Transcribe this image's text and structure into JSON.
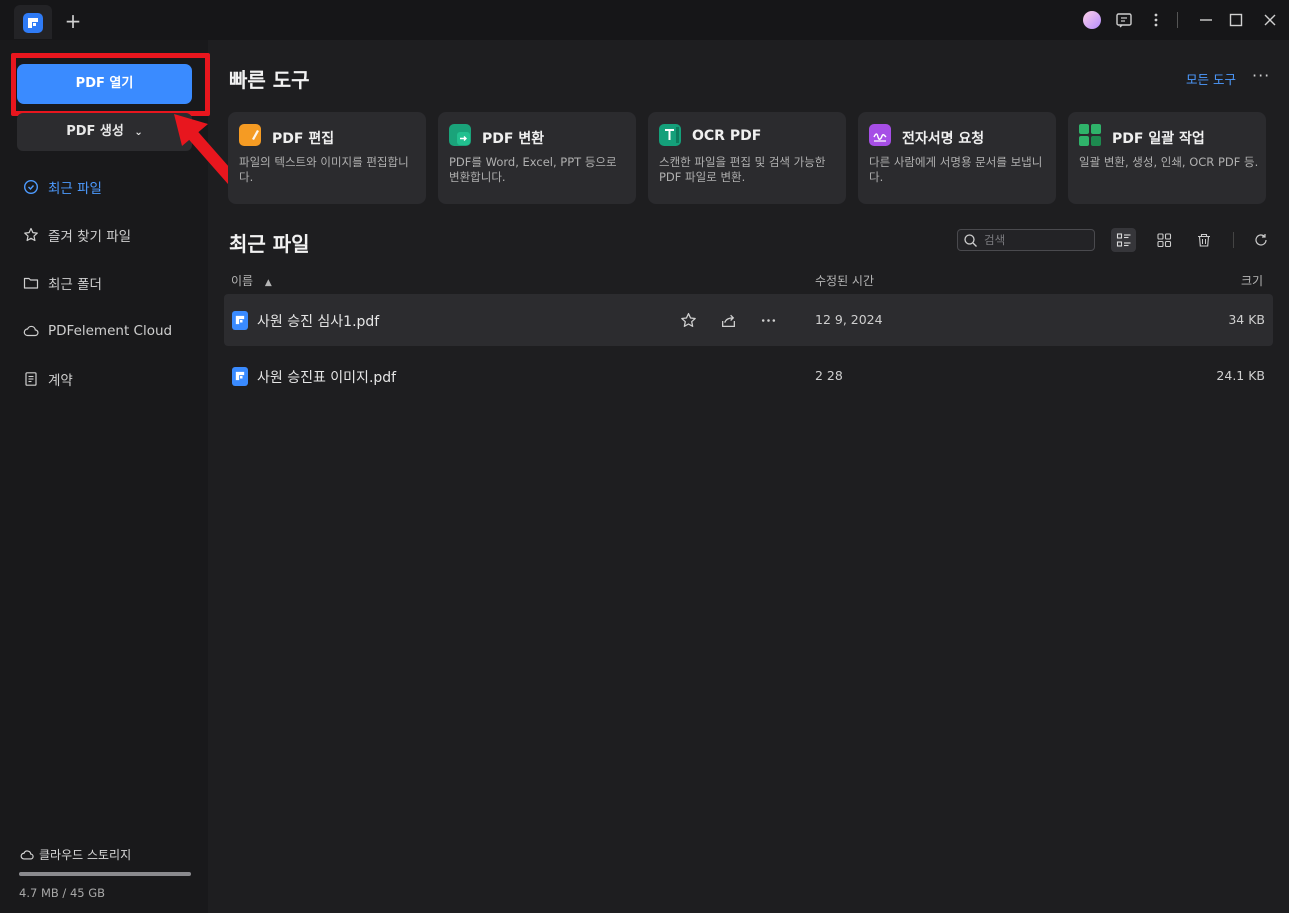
{
  "titlebar": {
    "new_tab": "+"
  },
  "sidebar": {
    "open_pdf": "PDF 열기",
    "create_pdf": "PDF 생성",
    "nav": [
      {
        "label": "최근 파일",
        "icon": "clock-icon",
        "active": true
      },
      {
        "label": "즐겨 찾기 파일",
        "icon": "star-icon",
        "active": false
      },
      {
        "label": "최근 폴더",
        "icon": "folder-icon",
        "active": false
      },
      {
        "label": "PDFelement Cloud",
        "icon": "cloud-icon",
        "active": false
      },
      {
        "label": "계약",
        "icon": "document-icon",
        "active": false
      }
    ],
    "storage": {
      "label": "클라우드 스토리지",
      "value": "4.7 MB / 45 GB",
      "used_fraction": 0.0001
    }
  },
  "quick_tools": {
    "title": "빠른 도구",
    "all_tools": "모든 도구",
    "more": "···",
    "cards": [
      {
        "title": "PDF 편집",
        "desc": "파일의 텍스트와 이미지를 편집합니다.",
        "icon": "edit-pdf-icon",
        "color": "#f59b23"
      },
      {
        "title": "PDF 변환",
        "desc": "PDF를 Word, Excel, PPT 등으로 변환합니다.",
        "icon": "convert-pdf-icon",
        "color": "#1aa37a"
      },
      {
        "title": "OCR PDF",
        "desc": "스캔한 파일을 편집 및 검색 가능한 PDF 파일로 변환.",
        "icon": "ocr-icon",
        "color": "#14a07a"
      },
      {
        "title": "전자서명 요청",
        "desc": "다른 사람에게 서명용 문서를 보냅니다.",
        "icon": "signature-icon",
        "color": "#a64ee6"
      },
      {
        "title": "PDF 일괄 작업",
        "desc": "일괄 변환, 생성, 인쇄, OCR PDF 등.",
        "icon": "batch-icon",
        "color": "#2fb36a"
      }
    ]
  },
  "recent": {
    "title": "최근 파일",
    "search_placeholder": "검색",
    "columns": {
      "name": "이름",
      "sort_indicator": "▲",
      "modified": "수정된 시간",
      "size": "크기"
    },
    "files": [
      {
        "name": "사원 승진 심사1.pdf",
        "modified": "12 9, 2024",
        "size": "34 KB",
        "selected": true
      },
      {
        "name": "사원 승진표 이미지.pdf",
        "modified": "2 28",
        "size": "24.1 KB",
        "selected": false
      }
    ]
  }
}
